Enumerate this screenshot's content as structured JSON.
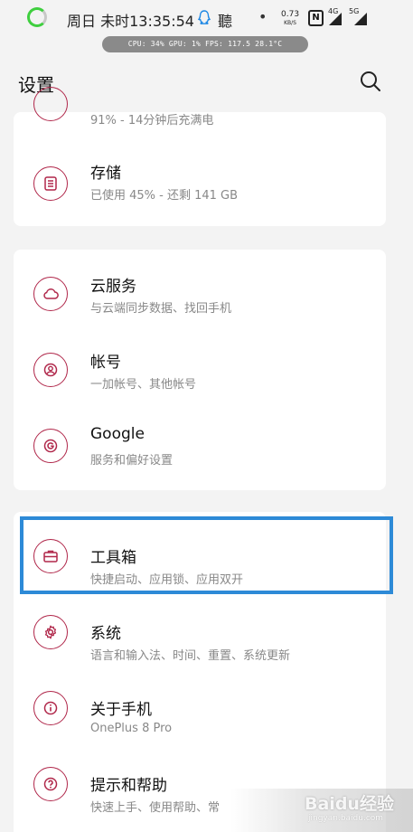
{
  "status_bar": {
    "time": "周日 未时13:35:54",
    "ting": "聽",
    "dot": "•",
    "net_speed": "0.73",
    "net_unit": "KB/S",
    "nfc": "N",
    "signal_1": "4G",
    "signal_2": "5G",
    "perf": "CPU: 34%   GPU: 1%   FPS: 117.5  28.1°C"
  },
  "header": {
    "title": "设置"
  },
  "items": {
    "battery": {
      "subtitle": "91% - 14分钟后充满电"
    },
    "storage": {
      "title": "存储",
      "subtitle": "已使用 45% - 还剩 141 GB"
    },
    "cloud": {
      "title": "云服务",
      "subtitle": "与云端同步数据、找回手机"
    },
    "account": {
      "title": "帐号",
      "subtitle": "一加帐号、其他帐号"
    },
    "google": {
      "title": "Google",
      "subtitle": "服务和偏好设置"
    },
    "toolbox": {
      "title": "工具箱",
      "subtitle": "快捷启动、应用锁、应用双开"
    },
    "system": {
      "title": "系统",
      "subtitle": "语言和输入法、时间、重置、系统更新"
    },
    "about": {
      "title": "关于手机",
      "subtitle": "OnePlus 8 Pro"
    },
    "help": {
      "title": "提示和帮助",
      "subtitle": "快速上手、使用帮助、常"
    }
  },
  "watermark": {
    "main": "Baidu经验",
    "sub": "jingyan.baidu.com"
  },
  "colors": {
    "accent": "#b0274a",
    "highlight": "#2d8ad7",
    "background": "#f3f3f3"
  }
}
